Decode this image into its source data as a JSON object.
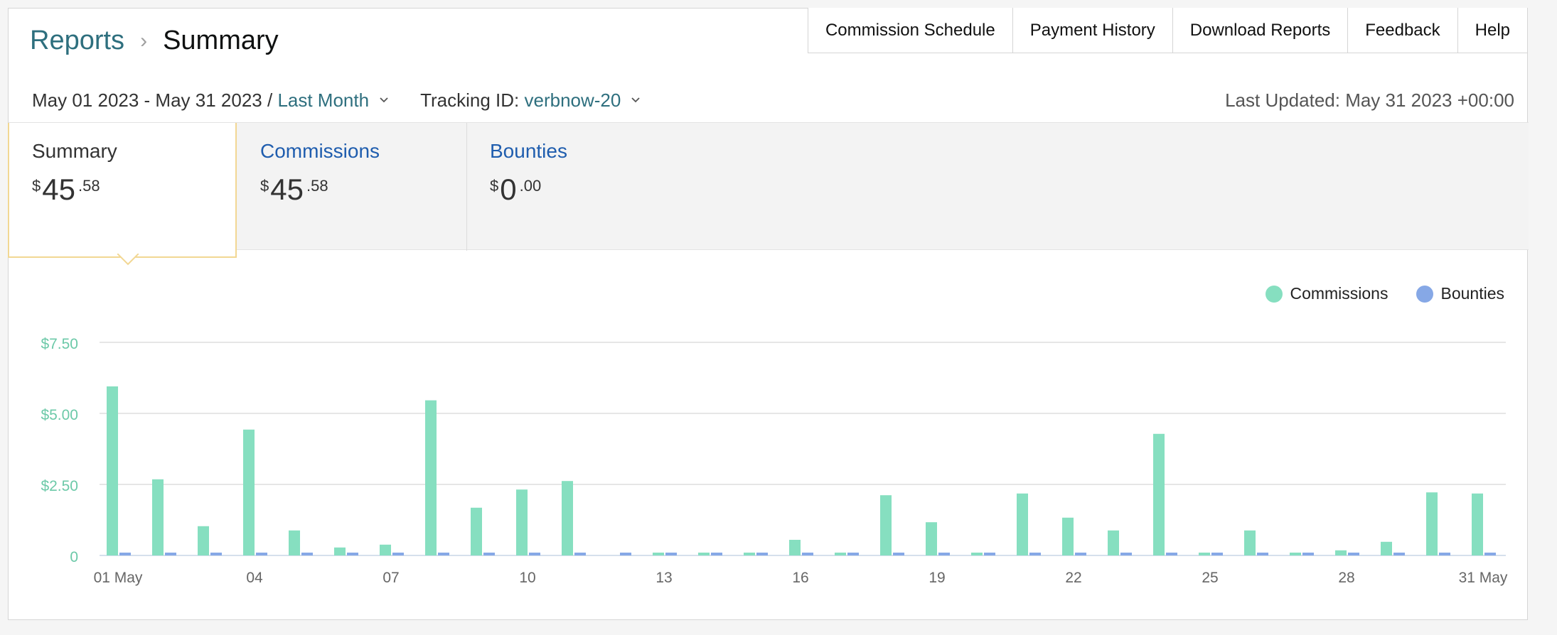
{
  "breadcrumb": {
    "parent": "Reports",
    "separator": "›",
    "current": "Summary"
  },
  "top_nav": [
    "Commission Schedule",
    "Payment History",
    "Download Reports",
    "Feedback",
    "Help"
  ],
  "filters": {
    "date_range": "May 01 2023 - May 31 2023 /",
    "period": "Last Month",
    "tracking_label": "Tracking ID:",
    "tracking_id": "verbnow-20"
  },
  "last_updated": "Last Updated: May 31 2023 +00:00",
  "tabs": [
    {
      "label": "Summary",
      "currency": "$",
      "whole": "45",
      "fraction": ".58",
      "active": true
    },
    {
      "label": "Commissions",
      "currency": "$",
      "whole": "45",
      "fraction": ".58",
      "active": false
    },
    {
      "label": "Bounties",
      "currency": "$",
      "whole": "0",
      "fraction": ".00",
      "active": false
    }
  ],
  "legend": [
    {
      "label": "Commissions",
      "color": "#86dfc0"
    },
    {
      "label": "Bounties",
      "color": "#86a8e6"
    }
  ],
  "colors": {
    "accent_link": "#2e6f7e",
    "tab_link": "#1f5dae",
    "axis_label": "#6cc9a8",
    "active_border": "#f2d793"
  },
  "chart_data": {
    "type": "bar",
    "categories": [
      "01 May",
      "02",
      "03",
      "04",
      "05",
      "06",
      "07",
      "08",
      "09",
      "10",
      "11",
      "12",
      "13",
      "14",
      "15",
      "16",
      "17",
      "18",
      "19",
      "20",
      "21",
      "22",
      "23",
      "24",
      "25",
      "26",
      "27",
      "28",
      "29",
      "30",
      "31 May"
    ],
    "x_tick_labels": [
      "01 May",
      "04",
      "07",
      "10",
      "13",
      "16",
      "19",
      "22",
      "25",
      "28",
      "31 May"
    ],
    "x_tick_indices": [
      0,
      3,
      6,
      9,
      12,
      15,
      18,
      21,
      24,
      27,
      30
    ],
    "y_tick_labels": [
      "0",
      "$2.50",
      "$5.00",
      "$7.50"
    ],
    "y_tick_values": [
      0,
      2.5,
      5,
      7.5
    ],
    "ylim": [
      0,
      7.5
    ],
    "series": [
      {
        "name": "Commissions",
        "values": [
          5.95,
          2.68,
          1.03,
          4.43,
          0.88,
          0.28,
          0.38,
          5.46,
          1.68,
          2.32,
          2.62,
          0,
          0.1,
          0.1,
          0.1,
          0.55,
          0.1,
          2.12,
          1.17,
          0.1,
          2.18,
          1.33,
          0.88,
          4.28,
          0.1,
          0.88,
          0.1,
          0.18,
          0.48,
          2.22,
          2.18
        ]
      },
      {
        "name": "Bounties",
        "values": [
          0.1,
          0.1,
          0.1,
          0.1,
          0.1,
          0.1,
          0.1,
          0.1,
          0.1,
          0.1,
          0.1,
          0.1,
          0.1,
          0.1,
          0.1,
          0.1,
          0.1,
          0.1,
          0.1,
          0.1,
          0.1,
          0.1,
          0.1,
          0.1,
          0.1,
          0.1,
          0.1,
          0.1,
          0.1,
          0.1,
          0.1
        ]
      }
    ]
  }
}
